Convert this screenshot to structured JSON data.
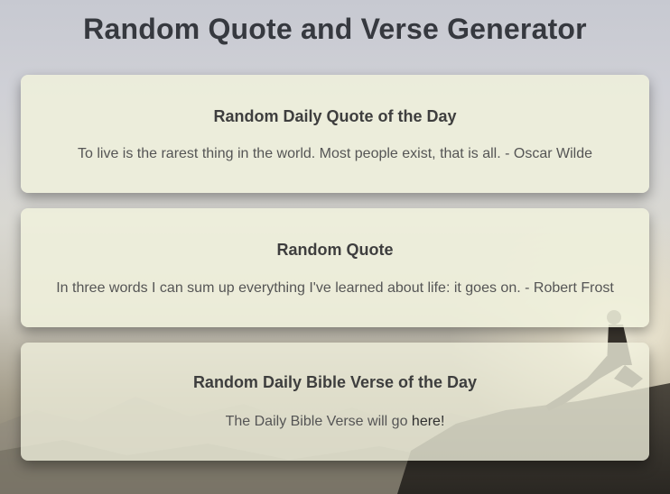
{
  "page": {
    "title": "Random Quote and Verse Generator"
  },
  "cards": [
    {
      "title": "Random Daily Quote of the Day",
      "text": "To live is the rarest thing in the world. Most people exist, that is all. - Oscar Wilde"
    },
    {
      "title": "Random Quote",
      "text": "In three words I can sum up everything I've learned about life: it goes on. - Robert Frost"
    },
    {
      "title": "Random Daily Bible Verse of the Day",
      "text_prefix": "The Daily Bible Verse will go ",
      "link_text": "here!"
    }
  ],
  "colors": {
    "title": "#36393f",
    "card_background": "#eff0dc",
    "card_text": "#555555"
  }
}
